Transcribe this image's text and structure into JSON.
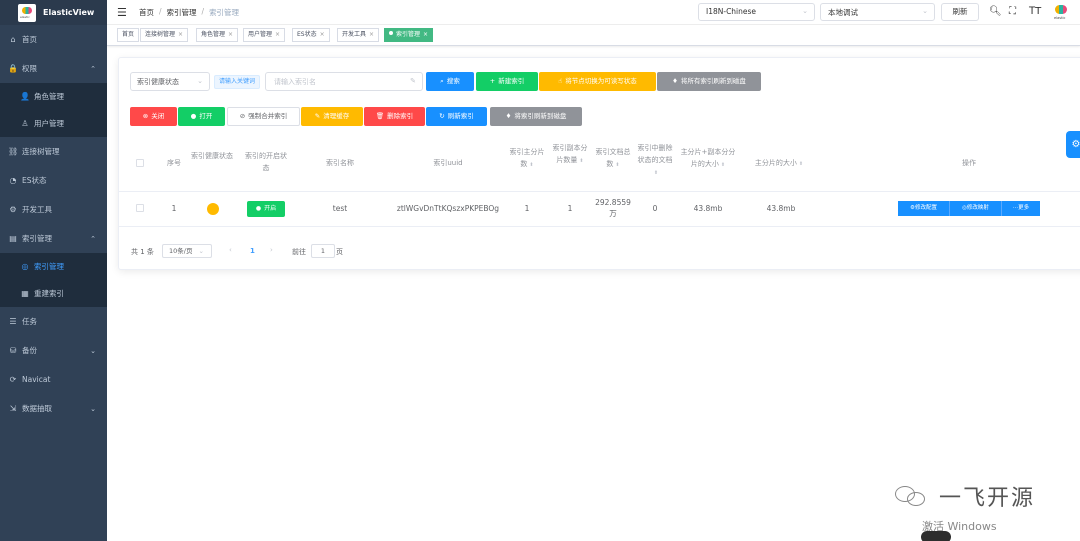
{
  "app": {
    "name": "ElasticView"
  },
  "sidebar": {
    "items": [
      {
        "label": "首页",
        "icon": "home-icon",
        "glyph": "⌂"
      },
      {
        "label": "权限",
        "icon": "lock-icon",
        "glyph": "🔒",
        "arrow": "⌃"
      },
      {
        "label": "角色管理",
        "icon": "user-icon",
        "glyph": "👤",
        "sub": true
      },
      {
        "label": "用户管理",
        "icon": "person-icon",
        "glyph": "♙",
        "sub": true
      },
      {
        "label": "连接树管理",
        "icon": "link-icon",
        "glyph": "⛓"
      },
      {
        "label": "ES状态",
        "icon": "gauge-icon",
        "glyph": "◔"
      },
      {
        "label": "开发工具",
        "icon": "tool-icon",
        "glyph": "⚙"
      },
      {
        "label": "索引管理",
        "icon": "index-icon",
        "glyph": "▤",
        "arrow": "⌃"
      },
      {
        "label": "索引管理",
        "icon": "database-icon",
        "glyph": "◎",
        "sub": true,
        "active": true
      },
      {
        "label": "重建索引",
        "icon": "rebuild-icon",
        "glyph": "▦",
        "sub": true
      },
      {
        "label": "任务",
        "icon": "task-icon",
        "glyph": "☰"
      },
      {
        "label": "备份",
        "icon": "backup-icon",
        "glyph": "⛁",
        "arrow": "⌄"
      },
      {
        "label": "Navicat",
        "icon": "navicat-icon",
        "glyph": "⟳"
      },
      {
        "label": "数据抽取",
        "icon": "extract-icon",
        "glyph": "⇲",
        "arrow": "⌄"
      }
    ]
  },
  "navbar": {
    "breadcrumb": [
      "首页",
      "索引管理",
      "索引管理"
    ],
    "language": "I18N-Chinese",
    "connection": "本地调试",
    "refresh": "刷新"
  },
  "tags": [
    "首页",
    "连接树管理",
    "角色管理",
    "用户管理",
    "ES状态",
    "开发工具",
    "索引管理"
  ],
  "toolbar": {
    "health_select": "索引健康状态",
    "keyword_chip": "请输入关键词",
    "search_placeholder": "请输入索引名",
    "search": "搜索",
    "new_index": "新建索引",
    "switch_writable": "将节点切换为可读写状态",
    "flush_all": "将所有索引刷新到磁盘",
    "close": "关闭",
    "open": "打开",
    "force_merge": "强制合并索引",
    "clear_cache": "清理缓存",
    "delete_index": "删除索引",
    "refresh_index": "刷新索引",
    "flush_index": "将索引刷新到磁盘"
  },
  "table": {
    "headers": {
      "no": "序号",
      "health": "索引健康状态",
      "open_state": "索引的开启状态",
      "name": "索引名称",
      "uuid": "索引uuid",
      "primary_shards": "索引主分片数",
      "replica_shards": "索引副本分片数量",
      "doc_count": "索引文档总数",
      "deleted_docs": "索引中删除状态的文档",
      "total_size": "主分片+副本分分片的大小",
      "primary_size": "主分片的大小",
      "actions": "操作"
    },
    "rows": [
      {
        "no": "1",
        "health_color": "#ffba00",
        "state": "开启",
        "name": "test",
        "uuid": "ztlWGvDnTtKQszxPKPEBOg",
        "primary_shards": "1",
        "replica_shards": "1",
        "doc_count": "292.8559万",
        "deleted_docs": "0",
        "total_size": "43.8mb",
        "primary_size": "43.8mb",
        "actions": [
          "修改配置",
          "修改映射",
          "更多"
        ]
      }
    ]
  },
  "pagination": {
    "total": "共 1 条",
    "page_size": "10条/页",
    "current": "1",
    "goto": "前往",
    "goto_value": "1",
    "page_suffix": "页"
  },
  "watermark": {
    "text": "一飞开源",
    "activate": "激活 Windows"
  },
  "colors": {
    "sidebar": "#304156",
    "primary": "#1890ff",
    "success": "#13ce66",
    "warning": "#ffba00",
    "danger": "#ff4949",
    "info": "#909399",
    "tag_active": "#42b983"
  }
}
